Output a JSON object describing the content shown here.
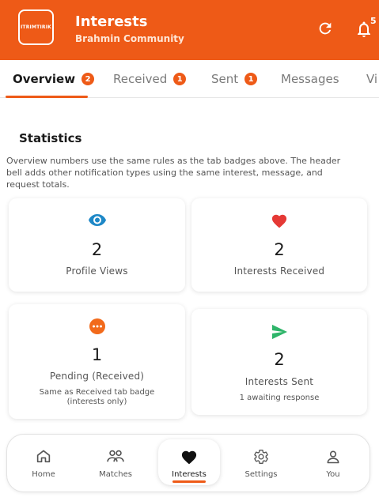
{
  "header": {
    "logo_text": "ITRIMTIRIK",
    "title": "Interests",
    "subtitle": "Brahmin Community",
    "notification_count": "5",
    "icons": {
      "refresh": "refresh-icon",
      "bell": "bell-icon"
    }
  },
  "tabs": [
    {
      "label": "Overview",
      "badge": "2",
      "active": true
    },
    {
      "label": "Received",
      "badge": "1",
      "active": false
    },
    {
      "label": "Sent",
      "badge": "1",
      "active": false
    },
    {
      "label": "Messages",
      "badge": "",
      "active": false
    },
    {
      "label": "Vi",
      "badge": "",
      "active": false
    }
  ],
  "statistics": {
    "title": "Statistics",
    "note": "Overview numbers use the same rules as the tab badges above. The header bell adds other notification types using the same interest, message, and request totals.",
    "cards": [
      {
        "icon": "eye-icon",
        "value": "2",
        "label": "Profile Views",
        "sub": ""
      },
      {
        "icon": "heart-icon",
        "value": "2",
        "label": "Interests Received",
        "sub": ""
      },
      {
        "icon": "pending-icon",
        "value": "1",
        "label": "Pending (Received)",
        "sub": "Same as Received tab badge (interests only)"
      },
      {
        "icon": "send-icon",
        "value": "2",
        "label": "Interests Sent",
        "sub": "1 awaiting response"
      }
    ]
  },
  "bottom_nav": [
    {
      "icon": "home-icon",
      "label": "Home",
      "active": false
    },
    {
      "icon": "people-icon",
      "label": "Matches",
      "active": false
    },
    {
      "icon": "heart-icon",
      "label": "Interests",
      "active": true
    },
    {
      "icon": "gear-icon",
      "label": "Settings",
      "active": false
    },
    {
      "icon": "person-icon",
      "label": "You",
      "active": false
    }
  ],
  "colors": {
    "accent": "#ee5a17",
    "eye": "#1e88c7",
    "heart": "#e53935",
    "pending": "#f26a1b",
    "send": "#2fb56a"
  }
}
